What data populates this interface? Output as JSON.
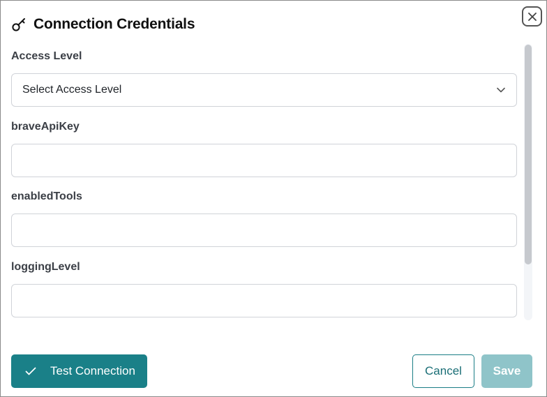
{
  "dialog": {
    "title": "Connection Credentials"
  },
  "fields": [
    {
      "label": "Access Level",
      "type": "select",
      "value": "Select Access Level"
    },
    {
      "label": "braveApiKey",
      "type": "text",
      "value": ""
    },
    {
      "label": "enabledTools",
      "type": "text",
      "value": ""
    },
    {
      "label": "loggingLevel",
      "type": "text",
      "value": ""
    }
  ],
  "footer": {
    "test_label": "Test Connection",
    "cancel_label": "Cancel",
    "save_label": "Save"
  },
  "icons": {
    "title": "key-icon",
    "close": "close-icon",
    "select": "chevron-down-icon",
    "test": "check-icon"
  },
  "colors": {
    "primary": "#1a8088",
    "primary_disabled": "#8fc4c9",
    "text_label": "#3b3f46",
    "border": "#d0d3d8"
  }
}
